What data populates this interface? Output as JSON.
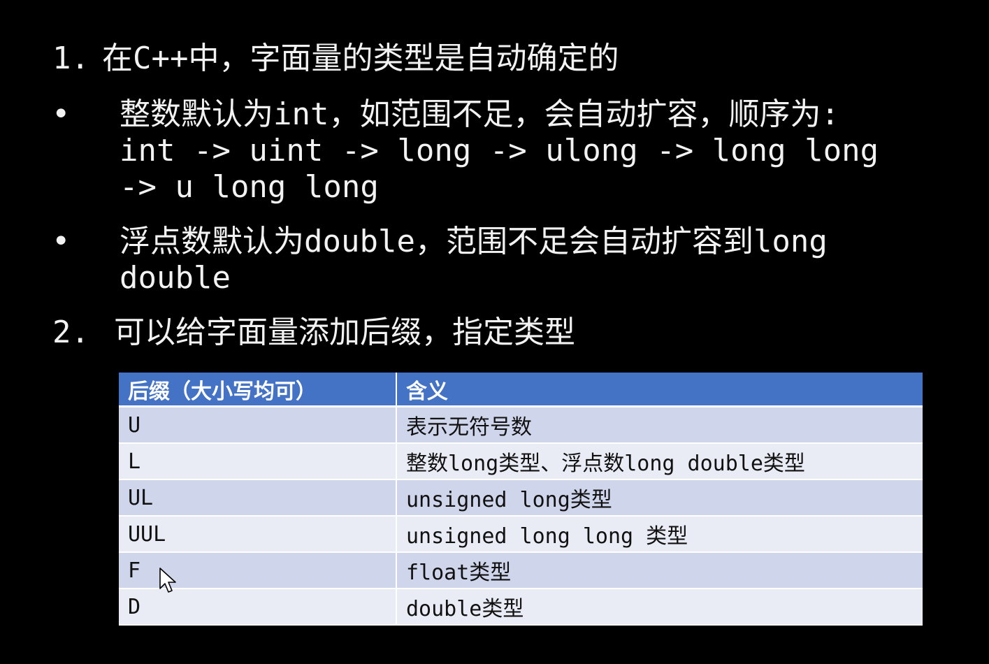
{
  "items": [
    {
      "number": "1.",
      "text": "在C++中，字面量的类型是自动确定的"
    },
    {
      "number": "2.",
      "text": "可以给字面量添加后缀，指定类型"
    }
  ],
  "bullets": [
    {
      "symbol": "•",
      "lines": [
        "整数默认为int，如范围不足，会自动扩容，顺序为:",
        "int -> uint -> long -> ulong -> long long",
        "-> u long long"
      ]
    },
    {
      "symbol": "•",
      "lines": [
        "浮点数默认为double，范围不足会自动扩容到long",
        "double"
      ]
    }
  ],
  "table": {
    "headers": [
      "后缀（大小写均可）",
      "含义"
    ],
    "rows": [
      [
        "U",
        "表示无符号数"
      ],
      [
        "L",
        "整数long类型、浮点数long double类型"
      ],
      [
        "UL",
        "unsigned long类型"
      ],
      [
        "UUL",
        "unsigned long long 类型"
      ],
      [
        "F",
        "float类型"
      ],
      [
        "D",
        "double类型"
      ]
    ]
  },
  "colors": {
    "background": "#000000",
    "text": "#f2f2f2",
    "header": "#4472c4",
    "row_odd": "#cfd5ea",
    "row_even": "#e9ebf5"
  },
  "icons": {
    "cursor": "mouse-pointer-icon"
  }
}
